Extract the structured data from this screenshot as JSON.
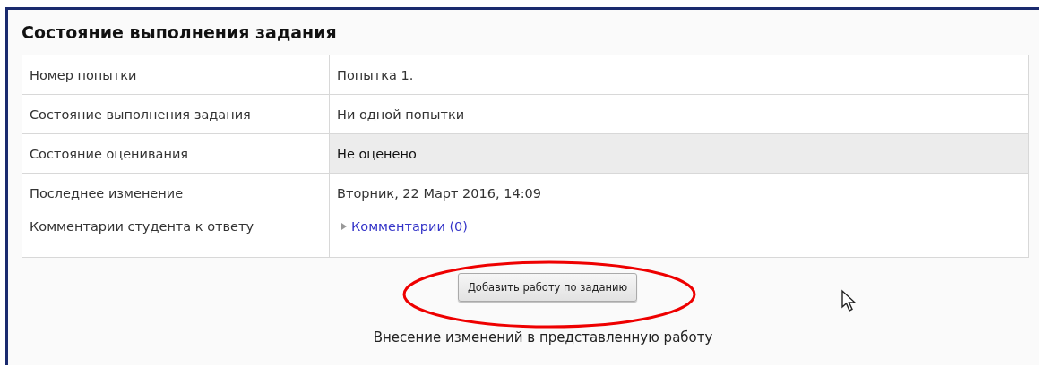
{
  "title": "Состояние выполнения задания",
  "rows": [
    {
      "kind": "text",
      "label": "Номер попытки",
      "value": "Попытка 1.",
      "highlighted": false
    },
    {
      "kind": "text",
      "label": "Состояние выполнения задания",
      "value": "Ни одной попытки",
      "highlighted": false
    },
    {
      "kind": "text",
      "label": "Состояние оценивания",
      "value": "Не оценено",
      "highlighted": true
    },
    {
      "kind": "text",
      "label": "Последнее изменение",
      "value": "Вторник, 22 Март 2016, 14:09",
      "highlighted": false
    },
    {
      "kind": "link",
      "label": "Комментарии студента к ответу",
      "value": "Комментарии (0)",
      "highlighted": false
    }
  ],
  "button": "Добавить работу по заданию",
  "note": "Внесение изменений в представленную работу"
}
